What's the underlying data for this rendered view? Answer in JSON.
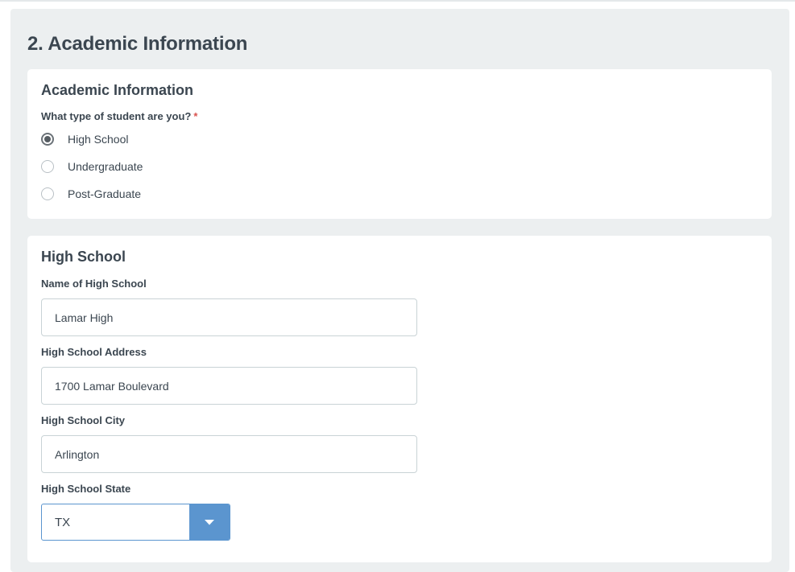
{
  "section": {
    "title": "2. Academic Information"
  },
  "academic_card": {
    "title": "Academic Information",
    "question": "What type of student are you?",
    "required_mark": "*",
    "options": [
      {
        "label": "High School",
        "selected": true
      },
      {
        "label": "Undergraduate",
        "selected": false
      },
      {
        "label": "Post-Graduate",
        "selected": false
      }
    ]
  },
  "high_school_card": {
    "title": "High School",
    "name_label": "Name of High School",
    "name_value": "Lamar High",
    "address_label": "High School Address",
    "address_value": "1700 Lamar Boulevard",
    "city_label": "High School City",
    "city_value": "Arlington",
    "state_label": "High School State",
    "state_value": "TX"
  },
  "icons": {
    "dropdown": "chevron-down-icon"
  },
  "colors": {
    "accent": "#5b95cf",
    "required": "#d9534f",
    "section_bg": "#eceff0",
    "text": "#3b4650"
  }
}
